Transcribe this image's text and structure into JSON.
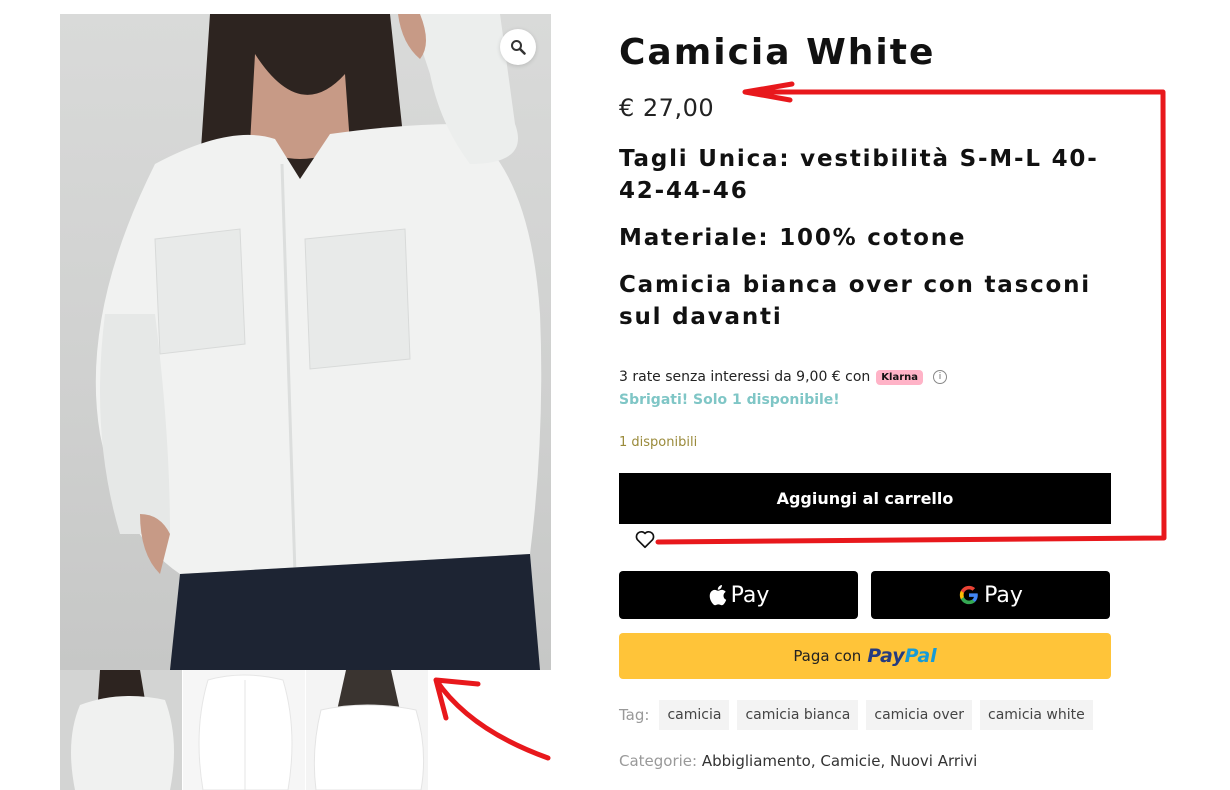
{
  "product": {
    "title": "Camicia White",
    "price": "€ 27,00",
    "description": [
      "Tagli Unica: vestibilità S-M-L  40-42-44-46",
      "Materiale: 100% cotone",
      "Camicia bianca over con tasconi sul davanti"
    ]
  },
  "gallery": {
    "zoom_icon": "magnifier-icon",
    "thumbnails": 3
  },
  "klarna": {
    "text": "3 rate senza interessi da 9,00 € con",
    "badge": "Klarna"
  },
  "urgency": "Sbrigati! Solo 1 disponibile!",
  "stock": "1 disponibili",
  "cart": {
    "add_label": "Aggiungi al carrello",
    "wishlist_icon": "heart-icon"
  },
  "payments": {
    "apple_label": "Pay",
    "google_label": "Pay",
    "paypal_prefix": "Paga con",
    "paypal_logo_a": "Pay",
    "paypal_logo_b": "Pal"
  },
  "tags": {
    "label": "Tag:",
    "items": [
      "camicia",
      "camicia bianca",
      "camicia over",
      "camicia white"
    ]
  },
  "categories": {
    "label": "Categorie:",
    "items": [
      "Abbigliamento",
      "Camicie",
      "Nuovi Arrivi"
    ]
  },
  "colors": {
    "annotation_red": "#e8181c",
    "klarna_pink": "#ffb3c7",
    "urgency_teal": "#7fc6c6",
    "stock_olive": "#9a8a3a",
    "paypal_yellow": "#ffc439"
  }
}
